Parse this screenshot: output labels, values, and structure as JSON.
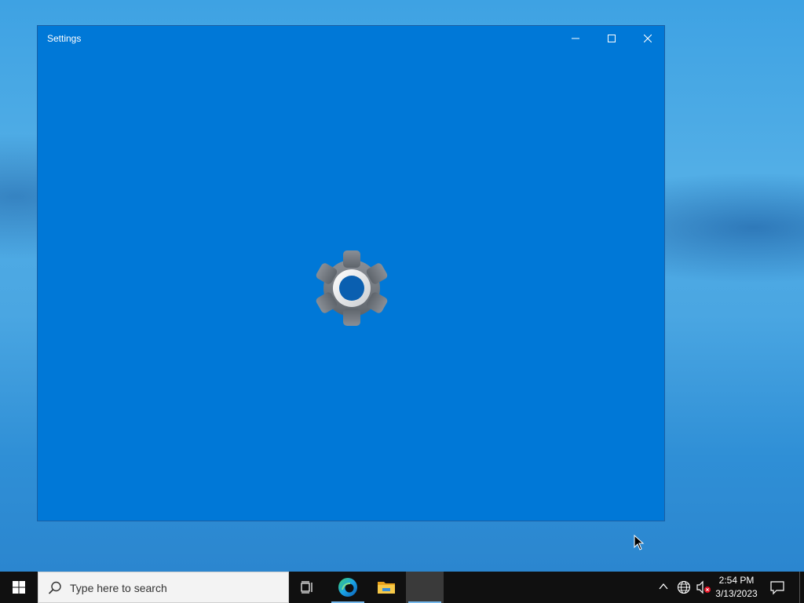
{
  "window": {
    "title": "Settings",
    "controls": {
      "minimize": "minimize-icon",
      "maximize": "maximize-icon",
      "close": "close-icon"
    },
    "background_color": "#0078d7",
    "splash_icon": "gear-icon"
  },
  "taskbar": {
    "start_icon": "windows-logo-icon",
    "search": {
      "placeholder": "Type here to search",
      "icon": "search-icon"
    },
    "apps": [
      {
        "name": "task-view",
        "icon": "task-view-icon"
      },
      {
        "name": "edge",
        "icon": "edge-icon"
      },
      {
        "name": "file-explorer",
        "icon": "folder-icon"
      },
      {
        "name": "settings",
        "icon": "settings-app-icon",
        "active": true
      }
    ],
    "tray": {
      "icons": [
        "chevron-up-icon",
        "network-icon",
        "volume-muted-icon"
      ],
      "time": "2:54 PM",
      "date": "3/13/2023",
      "notification_icon": "notification-icon"
    },
    "background_color": "#101010"
  }
}
